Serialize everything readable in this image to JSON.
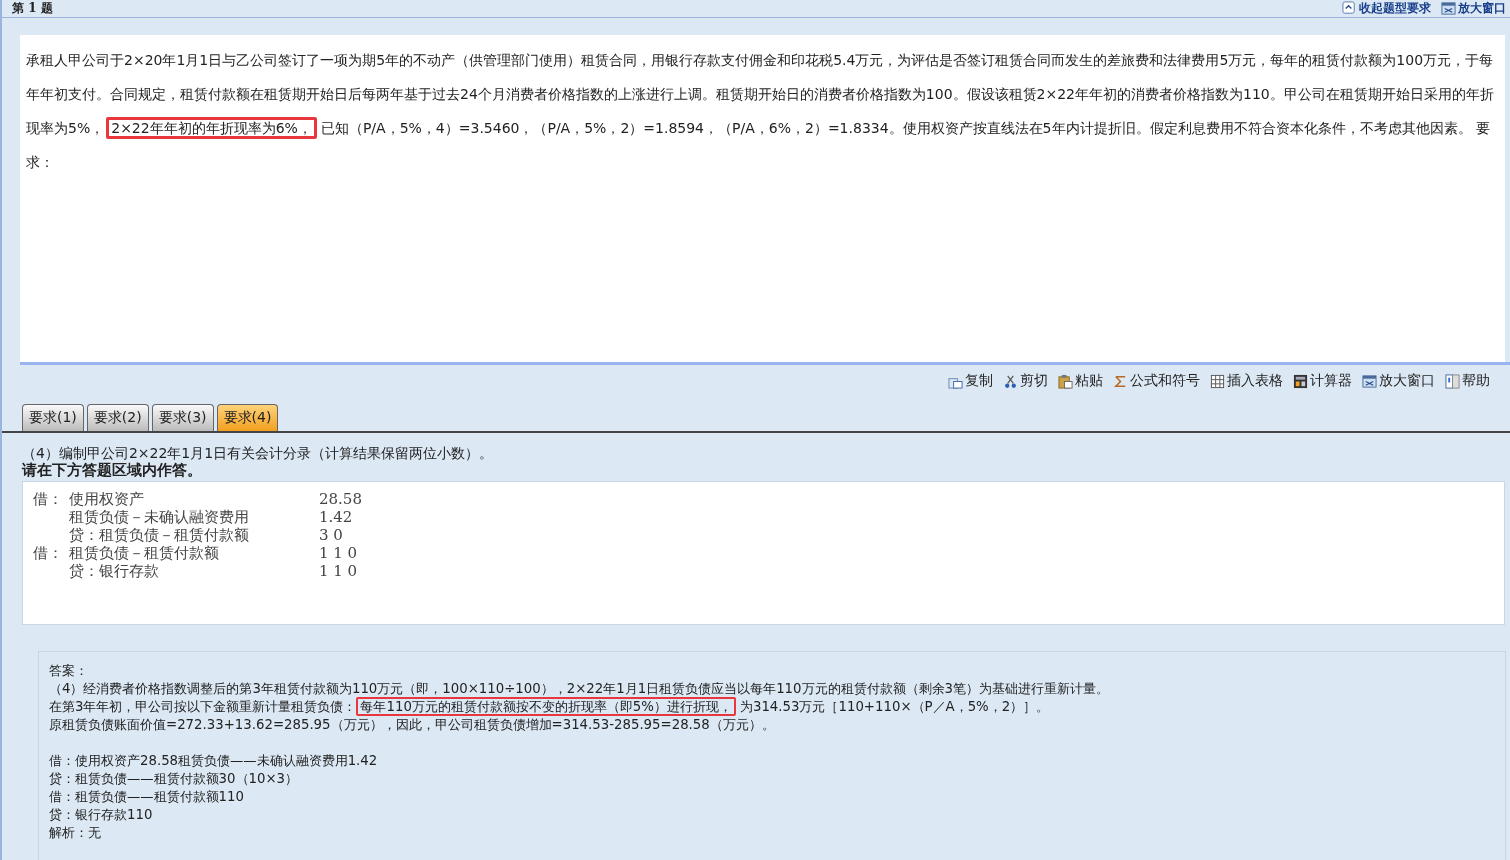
{
  "header": {
    "title": "第 1 题",
    "links": [
      {
        "label": "收起题型要求",
        "kind": "collapse"
      },
      {
        "label": "放大窗口",
        "kind": "window"
      }
    ]
  },
  "question": {
    "paragraph": [
      {
        "text": "承租人甲公司于2×20年1月1日与乙公司签订了一项为期5年的不动产（供管理部门使用）租赁合同，用银行存款支付佣金和印花税5.4万元，为评估是否签订租赁合同而发生的差旅费和法律费用5万元，每年的租赁付款额为100万元，于每年年初支付。合同规定，租赁付款额在租赁期开始日后每两年基于过去24个月消费者价格指数的上涨进行上调。租赁期开始日的消费者价格指数为100。假设该租赁2×22年年初的消费者价格指数为110。甲公司在租赁期开始日采用的年折现率为5%，",
        "highlight": false
      },
      {
        "text": "2×22年年初的年折现率为6%，",
        "highlight": true
      },
      {
        "text": "已知（P/A，5%，4）=3.5460，（P/A，5%，2）=1.8594，（P/A，6%，2）=1.8334。使用权资产按直线法在5年内计提折旧。假定利息费用不符合资本化条件，不考虑其他因素。 要求：",
        "highlight": false
      }
    ]
  },
  "toolbar": [
    {
      "label": "复制",
      "kind": "copy"
    },
    {
      "label": "剪切",
      "kind": "cut"
    },
    {
      "label": "粘贴",
      "kind": "paste"
    },
    {
      "label": "公式和符号",
      "kind": "sigma"
    },
    {
      "label": "插入表格",
      "kind": "table"
    },
    {
      "label": "计算器",
      "kind": "calculator"
    },
    {
      "label": "放大窗口",
      "kind": "window"
    },
    {
      "label": "帮助",
      "kind": "help"
    }
  ],
  "tabs": [
    {
      "label": "要求(1)",
      "selected": false
    },
    {
      "label": "要求(2)",
      "selected": false
    },
    {
      "label": "要求(3)",
      "selected": false
    },
    {
      "label": "要求(4)",
      "selected": true
    }
  ],
  "requirement": "（4）编制甲公司2×22年1月1日有关会计分录（计算结果保留两位小数）。",
  "instruction": "请在下方答题区域内作答。",
  "answer_entries": [
    {
      "prefix": "借：",
      "account": "使用权资产",
      "amount": "28.58"
    },
    {
      "account": "租赁负债－未确认融资费用",
      "amount": "1.42"
    },
    {
      "account": "贷：租赁负债－租赁付款额",
      "amount": "3 0"
    },
    {
      "prefix": "借：",
      "account": "租赁负债－租赁付款额",
      "amount": "1 1 0"
    },
    {
      "account": "贷：银行存款",
      "amount": "1 1 0"
    }
  ],
  "solution": {
    "explanation": [
      [
        {
          "text": "答案：",
          "highlight": false
        }
      ],
      [
        {
          "text": "（4）经消费者价格指数调整后的第3年租赁付款额为110万元（即，100×110÷100），2×22年1月1日租赁负债应当以每年110万元的租赁付款额（剩余3笔）为基础进行重新计量。",
          "highlight": false
        }
      ],
      [
        {
          "text": "在第3年年初，甲公司按以下金额重新计量租赁负债：",
          "highlight": false
        },
        {
          "text": "每年110万元的租赁付款额按不变的折现率（即5%）进行折现，",
          "highlight": true
        },
        {
          "text": "为314.53万元［110+110×（P／A，5%，2）］。",
          "highlight": false
        }
      ],
      [
        {
          "text": "原租赁负债账面价值=272.33+13.62=285.95（万元），因此，甲公司租赁负债增加=314.53-285.95=28.58（万元）。",
          "highlight": false
        }
      ]
    ],
    "entries": [
      [
        {
          "text": "借：使用权资产28.58租赁负债——未确认融资费用1.42",
          "highlight": false
        }
      ],
      [
        {
          "text": "贷：租赁负债——租赁付款额30（10×3）",
          "highlight": false
        }
      ],
      [
        {
          "text": "借：租赁负债——租赁付款额110",
          "highlight": false
        }
      ],
      [
        {
          "text": "贷：银行存款110",
          "highlight": false
        }
      ],
      [
        {
          "text": "解析：无",
          "highlight": false
        }
      ]
    ]
  }
}
